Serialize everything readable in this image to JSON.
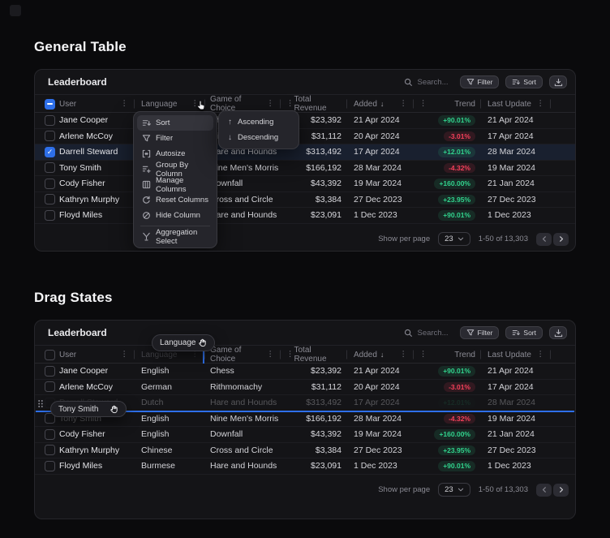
{
  "page": {
    "accent_color": "#2e6fe9",
    "positive_color": "#31d38d",
    "negative_color": "#f4405a",
    "background_color": "#0a0a0c"
  },
  "sections": [
    {
      "heading": "General Table"
    },
    {
      "heading": "Drag States"
    }
  ],
  "table": {
    "title": "Leaderboard",
    "toolbar": {
      "search_placeholder": "Search...",
      "filter_label": "Filter",
      "sort_label": "Sort",
      "download_icon": "tray-arrow-down"
    },
    "columns": [
      {
        "key": "user",
        "label": "User"
      },
      {
        "key": "language",
        "label": "Language"
      },
      {
        "key": "game",
        "label": "Game of Choice"
      },
      {
        "key": "revenue",
        "label": "Total Revenue",
        "align": "right"
      },
      {
        "key": "added",
        "label": "Added",
        "sorted": "desc"
      },
      {
        "key": "trend",
        "label": "Trend",
        "align": "right"
      },
      {
        "key": "last_update",
        "label": "Last Update"
      }
    ],
    "rows": [
      {
        "user": "Jane Cooper",
        "language": "English",
        "game": "Chess",
        "revenue": "$23,392",
        "added": "21 Apr 2024",
        "trend": "+90.01%",
        "trend_dir": "up",
        "last_update": "21 Apr 2024"
      },
      {
        "user": "Arlene McCoy",
        "language": "German",
        "game": "Rithmomachy",
        "revenue": "$31,112",
        "added": "20 Apr 2024",
        "trend": "-3.01%",
        "trend_dir": "down",
        "last_update": "17 Apr 2024"
      },
      {
        "user": "Darrell Steward",
        "language": "Dutch",
        "game": "Hare and Hounds",
        "revenue": "$313,492",
        "added": "17 Apr 2024",
        "trend": "+12.01%",
        "trend_dir": "up",
        "last_update": "28 Mar 2024"
      },
      {
        "user": "Tony Smith",
        "language": "English",
        "game": "Nine Men's Morris",
        "revenue": "$166,192",
        "added": "28 Mar 2024",
        "trend": "-4.32%",
        "trend_dir": "down",
        "last_update": "19 Mar 2024"
      },
      {
        "user": "Cody Fisher",
        "language": "English",
        "game": "Downfall",
        "revenue": "$43,392",
        "added": "19 Mar 2024",
        "trend": "+160.00%",
        "trend_dir": "up",
        "last_update": "21 Jan 2024"
      },
      {
        "user": "Kathryn Murphy",
        "language": "Chinese",
        "game": "Cross and Circle",
        "revenue": "$3,384",
        "added": "27 Dec 2023",
        "trend": "+23.95%",
        "trend_dir": "up",
        "last_update": "27 Dec 2023"
      },
      {
        "user": "Floyd Miles",
        "language": "Burmese",
        "game": "Hare and Hounds",
        "revenue": "$23,091",
        "added": "1 Dec 2023",
        "trend": "+90.01%",
        "trend_dir": "up",
        "last_update": "1 Dec 2023"
      }
    ],
    "footer": {
      "show_per_page_label": "Show per page",
      "page_size": "23",
      "range_label": "1-50 of 13,303"
    }
  },
  "menu": {
    "items": [
      {
        "label": "Sort",
        "icon": "sort-lines",
        "active": true
      },
      {
        "label": "Filter",
        "icon": "funnel"
      },
      {
        "label": "Autosize",
        "icon": "bracket-arrows"
      },
      {
        "label": "Group By Column",
        "icon": "group-rows-plus"
      },
      {
        "label": "Manage Columns",
        "icon": "table-columns"
      },
      {
        "label": "Reset Columns",
        "icon": "refresh-arrow"
      },
      {
        "label": "Hide Column",
        "icon": "slashed-circle"
      },
      {
        "label": "Aggregation Select",
        "icon": "funnel-y"
      }
    ],
    "submenu": [
      {
        "label": "Ascending",
        "icon": "arrow-up",
        "glyph": "↑"
      },
      {
        "label": "Descending",
        "icon": "arrow-down",
        "glyph": "↓"
      }
    ]
  },
  "drag": {
    "column_pill_label": "Language",
    "row_pill_label": "Tony Smith",
    "dragged_column": "Language",
    "dragged_row_user": "Tony Smith"
  },
  "states": {
    "general": {
      "selected_row": 2
    },
    "drag": {
      "ghost_row": 2,
      "ghost_user_row": 3,
      "drop_line_after_row": 2
    }
  },
  "glyphs": {
    "kebab": "⋮",
    "sort_desc_arrow": "↓",
    "check": "✓"
  }
}
